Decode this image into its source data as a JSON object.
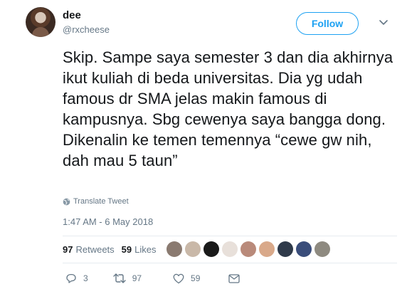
{
  "user": {
    "name": "dee",
    "handle": "@rxcheese"
  },
  "follow_label": "Follow",
  "tweet_text": "Skip. Sampe saya semester 3 dan dia akhirnya ikut kuliah di beda universitas. Dia yg udah famous dr SMA jelas makin famous di kampusnya. Sbg cewenya saya bangga dong. Dikenalin ke temen temennya “cewe gw nih, dah mau 5 taun”",
  "translate_label": "Translate Tweet",
  "timestamp": "1:47 AM - 6 May 2018",
  "stats": {
    "retweets_count": "97",
    "retweets_label": "Retweets",
    "likes_count": "59",
    "likes_label": "Likes"
  },
  "likers": [
    {
      "icon": "liker-avatar-1",
      "color": "#8a7a70"
    },
    {
      "icon": "liker-avatar-2",
      "color": "#c9b8a8"
    },
    {
      "icon": "liker-avatar-3",
      "color": "#1a1a1a"
    },
    {
      "icon": "liker-avatar-4",
      "color": "#e8e0da"
    },
    {
      "icon": "liker-avatar-5",
      "color": "#b98a7a"
    },
    {
      "icon": "liker-avatar-6",
      "color": "#d9a98a"
    },
    {
      "icon": "liker-avatar-7",
      "color": "#2f3a4a"
    },
    {
      "icon": "liker-avatar-8",
      "color": "#3a4d7a"
    },
    {
      "icon": "liker-avatar-9",
      "color": "#8e8a80"
    }
  ],
  "actions": {
    "replies": "3",
    "retweets": "97",
    "likes": "59"
  },
  "colors": {
    "accent": "#1da1f2",
    "secondary_text": "#657786",
    "primary_text": "#14171a",
    "divider": "#e6ecf0"
  }
}
